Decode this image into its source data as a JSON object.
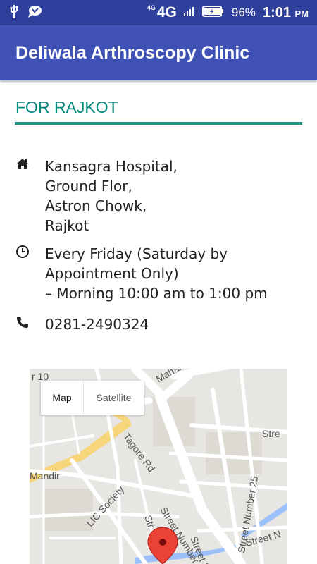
{
  "status_bar": {
    "network_sup": "4G",
    "network": "4G",
    "battery": "96%",
    "time": "1:01",
    "ampm": "PM",
    "icons": [
      "usb-icon",
      "chat-icon",
      "signal-icon",
      "battery-icon"
    ]
  },
  "app_bar": {
    "title": "Deliwala Arthroscopy Clinic"
  },
  "section": {
    "title": "FOR RAJKOT",
    "accent": "#00897b"
  },
  "address": {
    "lines": [
      "Kansagra Hospital,",
      "Ground Flor,",
      "Astron Chowk,",
      "Rajkot"
    ],
    "icon": "home-icon"
  },
  "timing": {
    "lines": [
      "Every Friday (Saturday by",
      "Appointment Only)",
      "– Morning 10:00 am to 1:00 pm"
    ],
    "icon": "clock-icon"
  },
  "phone": {
    "number": "0281-2490324",
    "icon": "phone-icon"
  },
  "map": {
    "map_btn": "Map",
    "satellite_btn": "Satellite",
    "labels": {
      "mahakal": "Mahakal",
      "road10": "r 10",
      "tagore": "Tagore Rd",
      "mandir": "Mandir",
      "lic": "LIC Society",
      "street25": "Street Number 25",
      "stre": "Stre",
      "street_number": "Street Number",
      "street_n": "Street N",
      "street_num": "Street Num",
      "str": "Str"
    },
    "colors": {
      "marker": "#ea4335",
      "road": "#ffffff",
      "highway": "#f6d57b",
      "water": "#9cc0f9"
    }
  }
}
